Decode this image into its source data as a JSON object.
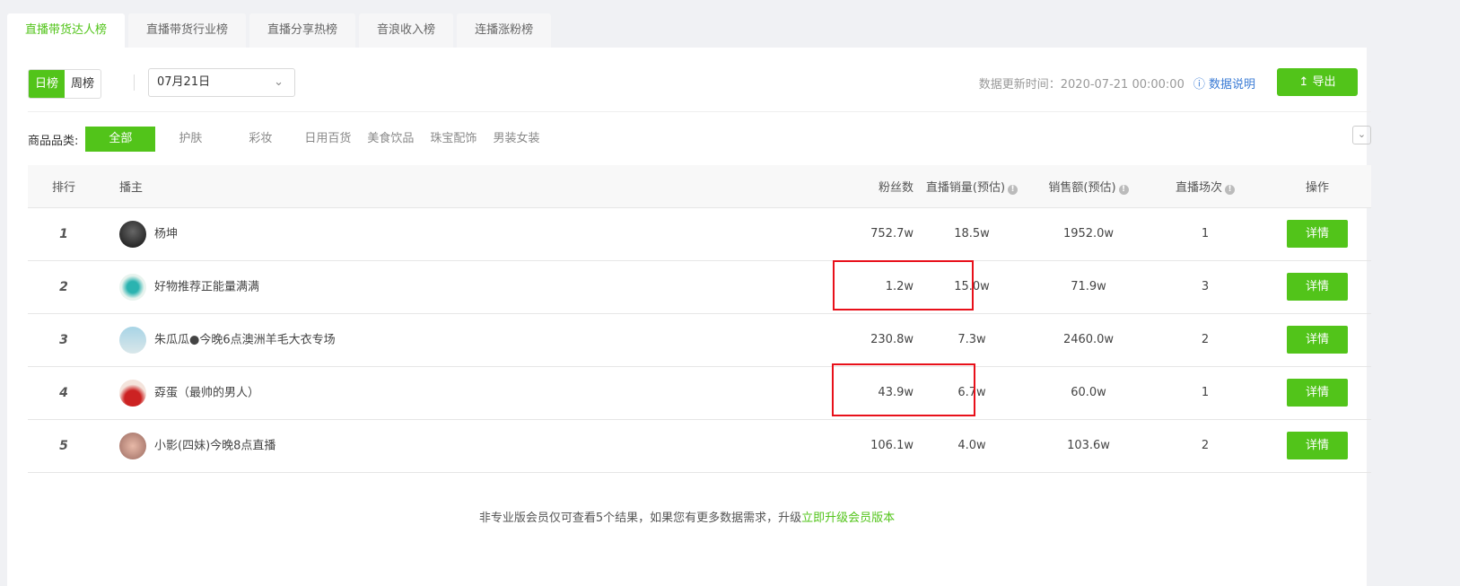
{
  "tabs": [
    "直播带货达人榜",
    "直播带货行业榜",
    "直播分享热榜",
    "音浪收入榜",
    "连播涨粉榜"
  ],
  "period": {
    "options": [
      "日榜",
      "周榜"
    ],
    "selected": "日榜"
  },
  "date": "07月21日",
  "update_time": "数据更新时间：2020-07-21 00:00:00",
  "help_label": "数据说明",
  "export_label": "导出",
  "category": {
    "label": "商品品类:",
    "items": [
      "全部",
      "护肤",
      "彩妆",
      "日用百货",
      "美食饮品",
      "珠宝配饰",
      "男装女装"
    ],
    "selected": "全部"
  },
  "table": {
    "headers": {
      "rank": "排行",
      "streamer": "播主",
      "fans": "粉丝数",
      "sales": "直播销量(预估)",
      "amount": "销售额(预估)",
      "sessions": "直播场次",
      "action": "操作"
    },
    "rows": [
      {
        "rank": "1",
        "name": "杨坤",
        "fans": "752.7w",
        "sales": "18.5w",
        "amount": "1952.0w",
        "sessions": "1",
        "action": "详情"
      },
      {
        "rank": "2",
        "name": "好物推荐正能量满满",
        "fans": "1.2w",
        "sales": "15.0w",
        "amount": "71.9w",
        "sessions": "3",
        "action": "详情"
      },
      {
        "rank": "3",
        "name": "朱瓜瓜●今晚6点澳洲羊毛大衣专场",
        "fans": "230.8w",
        "sales": "7.3w",
        "amount": "2460.0w",
        "sessions": "2",
        "action": "详情"
      },
      {
        "rank": "4",
        "name": "孬蛋（最帅的男人）",
        "fans": "43.9w",
        "sales": "6.7w",
        "amount": "60.0w",
        "sessions": "1",
        "action": "详情"
      },
      {
        "rank": "5",
        "name": "小影(四妹)今晚8点直播",
        "fans": "106.1w",
        "sales": "4.0w",
        "amount": "103.6w",
        "sessions": "2",
        "action": "详情"
      }
    ]
  },
  "footer": {
    "text": "非专业版会员仅可查看5个结果，如果您有更多数据需求，升级",
    "link": "立即升级会员版本"
  },
  "colors": {
    "accent": "#52c41a",
    "highlight_box": "#e8101a"
  }
}
